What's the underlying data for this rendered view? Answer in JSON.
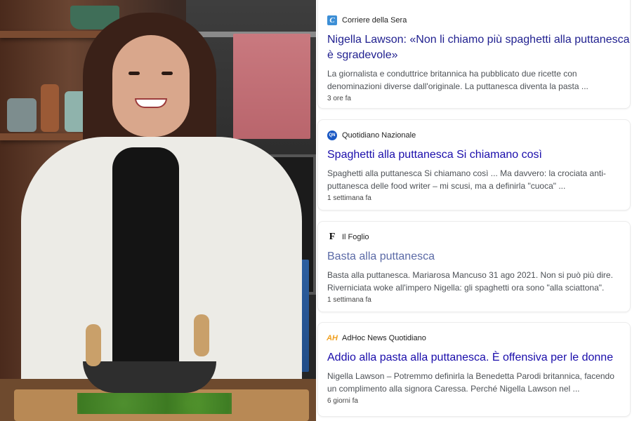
{
  "photo": {
    "alt": "Nigella Lawson in cucina con la mezzaluna"
  },
  "colors": {
    "headline": "#1a0dab",
    "headline_visited": "#5b6aa6",
    "snippet": "#4d5156",
    "card_border": "#ececec"
  },
  "news": {
    "items": [
      {
        "source": "Corriere della Sera",
        "logo_icon": "corriere-logo-icon",
        "logo_glyph": "C",
        "headline": "Nigella Lawson: «Non li chiamo più spaghetti alla puttanesca, è sgradevole»",
        "snippet": "La giornalista e conduttrice britannica ha pubblicato due ricette con denominazioni diverse dall'originale. La puttanesca diventa la pasta ...",
        "time": "3 ore fa"
      },
      {
        "source": "Quotidiano Nazionale",
        "logo_icon": "qn-logo-icon",
        "logo_glyph": "QN",
        "headline": "Spaghetti alla puttanesca Si chiamano così",
        "snippet": "Spaghetti alla puttanesca Si chiamano così ... Ma davvero: la crociata anti-puttanesca delle food writer – mi scusi, ma a definirla \"cuoca\" ...",
        "time": "1 settimana fa"
      },
      {
        "source": "Il Foglio",
        "logo_icon": "il-foglio-logo-icon",
        "logo_glyph": "F",
        "headline": "Basta alla puttanesca",
        "snippet": "Basta alla puttanesca. Mariarosa Mancuso 31 ago 2021. Non si può più dire. Riverniciata woke all'impero Nigella: gli spaghetti ora sono \"alla sciattona\".",
        "time": "1 settimana fa"
      },
      {
        "source": "AdHoc News Quotidiano",
        "logo_icon": "adhoc-logo-icon",
        "logo_glyph": "AH",
        "headline": "Addio alla pasta alla puttanesca. È offensiva per le donne",
        "snippet": "Nigella Lawson – Potremmo definirla la Benedetta Parodi britannica, facendo un complimento alla signora Caressa. Perché Nigella Lawson nel ...",
        "time": "6 giorni fa"
      }
    ]
  }
}
